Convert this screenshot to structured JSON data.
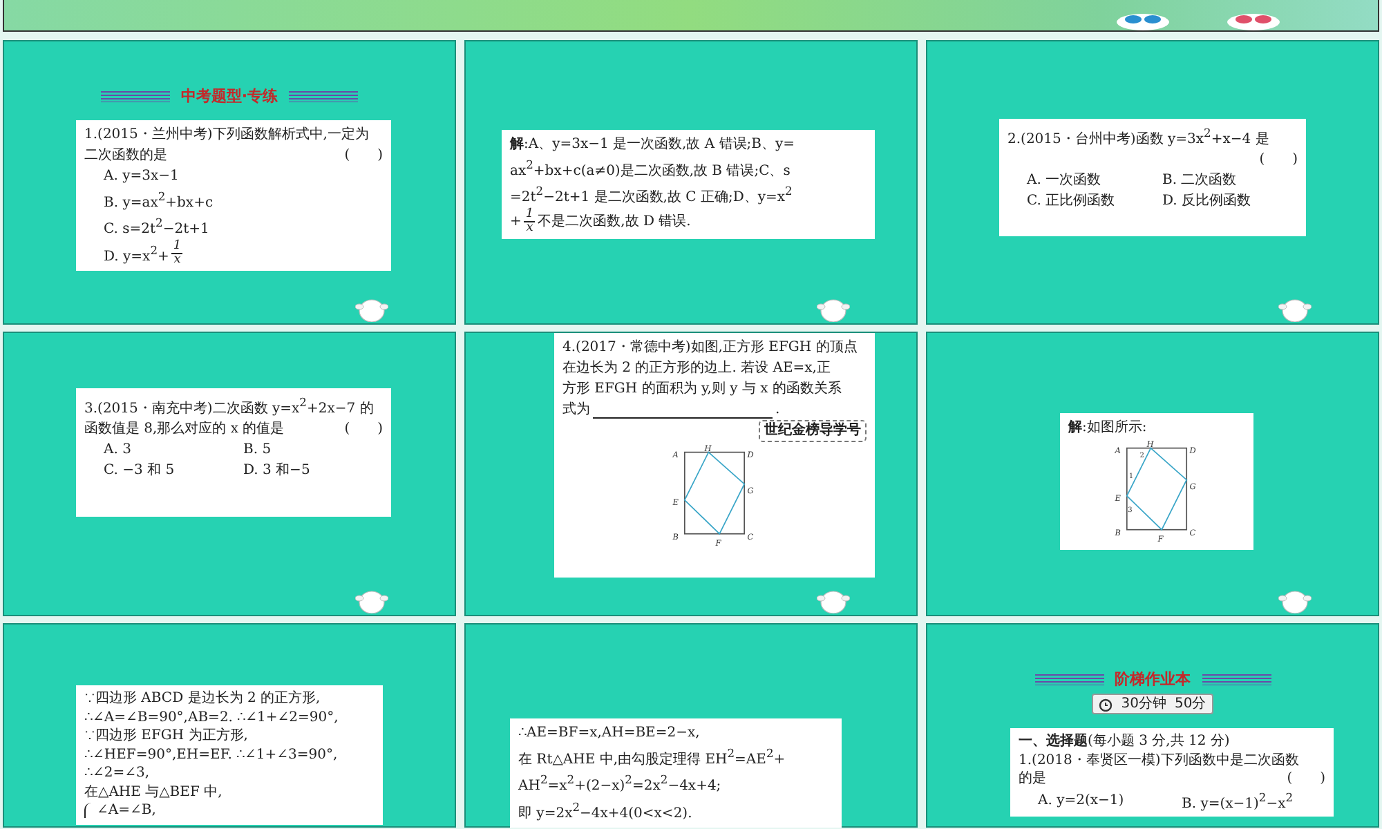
{
  "top_strip": {
    "ornaments": [
      {
        "color": "#2a8fd0"
      },
      {
        "color": "#e0506a"
      }
    ]
  },
  "slides": [
    {
      "mascot": true,
      "heading": "中考题型·专练",
      "box": [
        {
          "kind": "lines",
          "lines": [
            {
              "text": "1.(2015・兰州中考)下列函数解析式中,一定为"
            },
            {
              "text": "二次函数的是",
              "paren": "(　　)"
            }
          ]
        },
        {
          "kind": "options_list",
          "items": [
            {
              "text": "A. y=3x−1"
            },
            {
              "text": "B. y=ax$^{2}$+bx+c"
            },
            {
              "text": "C. s=2t$^{2}$−2t+1"
            },
            {
              "text": "D. y=x$^{2}$+",
              "frac": {
                "num": "1",
                "den": "x"
              }
            }
          ]
        }
      ]
    },
    {
      "mascot": true,
      "box": [
        {
          "kind": "lines",
          "lines": [
            {
              "text": "**解**:A、y=3x−1 是一次函数,故 A 错误;B、y="
            },
            {
              "text": "ax$^{2}$+bx+c(a≠0)是二次函数,故 B 错误;C、s"
            },
            {
              "text": "=2t$^{2}$−2t+1 是二次函数,故 C 正确;D、y=x$^{2}$"
            },
            {
              "text": "+",
              "frac": {
                "num": "1",
                "den": "x"
              },
              "after": "不是二次函数,故 D 错误."
            }
          ]
        }
      ]
    },
    {
      "mascot": true,
      "box": [
        {
          "kind": "lines",
          "lines": [
            {
              "text": "2.(2015・台州中考)函数 y=3x$^{2}$+x−4 是"
            },
            {
              "paren": "(　　)"
            }
          ]
        },
        {
          "kind": "options_grid",
          "items": [
            {
              "text": "A. 一次函数"
            },
            {
              "text": "B. 二次函数"
            },
            {
              "text": "C. 正比例函数"
            },
            {
              "text": "D. 反比例函数"
            }
          ]
        }
      ]
    },
    {
      "mascot": true,
      "box": [
        {
          "kind": "lines",
          "lines": [
            {
              "text": "3.(2015・南充中考)二次函数 y=x$^{2}$+2x−7 的"
            },
            {
              "text": "函数值是 8,那么对应的 x 的值是",
              "paren": "(　　)"
            }
          ]
        },
        {
          "kind": "options_grid",
          "items": [
            {
              "text": "A. 3"
            },
            {
              "text": "B. 5"
            },
            {
              "text": "C. −3 和 5"
            },
            {
              "text": "D. 3 和−5"
            }
          ]
        }
      ]
    },
    {
      "mascot": true,
      "box": [
        {
          "kind": "lines",
          "lines": [
            {
              "text": "4.(2017・常德中考)如图,正方形 EFGH 的顶点"
            },
            {
              "text": "在边长为 2 的正方形的边上. 若设 AE=x,正"
            },
            {
              "text": "方形 EFGH 的面积为 y,则 y 与 x 的函数关系"
            },
            {
              "text": "式为",
              "blank": true,
              "after": "."
            }
          ]
        },
        {
          "kind": "tag",
          "text": "世纪金榜导学号"
        },
        {
          "kind": "figure",
          "labels": [
            "A",
            "H",
            "D",
            "E",
            "G",
            "B",
            "F",
            "C"
          ]
        }
      ]
    },
    {
      "mascot": true,
      "box": [
        {
          "kind": "lines",
          "lines": [
            {
              "text": "**解**:如图所示:"
            }
          ]
        },
        {
          "kind": "figure",
          "labels": [
            "A",
            "H",
            "D",
            "E",
            "G",
            "B",
            "F",
            "C"
          ],
          "angles": [
            "1",
            "2",
            "3"
          ]
        }
      ]
    },
    {
      "mascot": false,
      "box": [
        {
          "kind": "lines",
          "lines": [
            {
              "text": "∵四边形 ABCD 是边长为 2 的正方形,"
            },
            {
              "text": "∴∠A=∠B=90°,AB=2. ∴∠1+∠2=90°,"
            },
            {
              "text": "∵四边形 EFGH 为正方形,"
            },
            {
              "text": "∴∠HEF=90°,EH=EF. ∴∠1+∠3=90°,"
            },
            {
              "text": "∴∠2=∠3,"
            },
            {
              "text": "在△AHE 与△BEF 中,"
            },
            {
              "text": "∠A=∠B,",
              "brace": true
            }
          ]
        }
      ]
    },
    {
      "mascot": false,
      "box": [
        {
          "kind": "lines",
          "lines": [
            {
              "text": "∴AE=BF=x,AH=BE=2−x,"
            },
            {
              "text": "在 Rt△AHE 中,由勾股定理得 EH$^{2}$=AE$^{2}$+"
            },
            {
              "text": "AH$^{2}$=x$^{2}$+(2−x)$^{2}$=2x$^{2}$−4x+4;"
            },
            {
              "text": "即 y=2x$^{2}$−4x+4(0<x<2)."
            }
          ]
        }
      ]
    },
    {
      "mascot": false,
      "heading": "阶梯作业本",
      "timer": [
        "30分钟",
        "50分"
      ],
      "box": [
        {
          "kind": "lines",
          "lines": [
            {
              "text": "**一、选择题**(每小题 3 分,共 12 分)"
            },
            {
              "text": "1.(2018・奉贤区一模)下列函数中是二次函数"
            },
            {
              "text": "的是",
              "paren": "(　　)"
            }
          ]
        },
        {
          "kind": "options_grid",
          "items": [
            {
              "text": "A. y=2(x−1)"
            },
            {
              "text": "B. y=(x−1)$^{2}$−x$^{2}$"
            }
          ]
        }
      ]
    }
  ]
}
